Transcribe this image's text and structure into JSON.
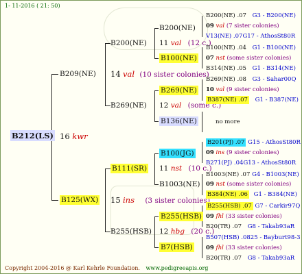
{
  "header": {
    "date": "1- 11-2016 ( 21: 50)"
  },
  "footer": {
    "copyright": "Copyright 2004-2016 @ Karl Kehrle Foundation.",
    "url": "www.pedigreeapis.org"
  },
  "root": {
    "name": "B212(LS)",
    "count": "16",
    "rel": "kwr"
  },
  "gen1": [
    {
      "name": "B209(NE)",
      "count": "14",
      "rel": "val",
      "note": "(10 sister colonies)"
    },
    {
      "name": "B125(WX)",
      "count": "15",
      "rel": "ins",
      "note": "(3 sister colonies)"
    }
  ],
  "gen2": [
    {
      "name": "B200(NE)",
      "count": "11",
      "rel": "val",
      "note": "(12 c.)"
    },
    {
      "name": "B269(NE)",
      "count": "12",
      "rel": "val",
      "note": "(some c.)"
    },
    {
      "name": "B111(SR)",
      "count": "11",
      "rel": "nst",
      "note": "(10 c.)"
    },
    {
      "name": "B255(HSB)",
      "count": "12",
      "rel": "hbg",
      "note": "(20 c.)"
    }
  ],
  "gen3": [
    {
      "name": "B200(NE)"
    },
    {
      "name": "B100(NE)"
    },
    {
      "name": "B269(NE)"
    },
    {
      "name": "B136(NE)"
    },
    {
      "name": "B100(JG)"
    },
    {
      "name": "B1003(NE)"
    },
    {
      "name": "B255(HSB)"
    },
    {
      "name": "B7(HSB)"
    }
  ],
  "gen4": {
    "g1": {
      "a": "B200(NE) .07",
      "b": "G3 - B200(NE)",
      "c": "09",
      "d": "val",
      "e": "(7 sister colonies)",
      "f": "V13(NE) .07G17 - AthosSt80R"
    },
    "g2": {
      "a": "B100(NE) .04",
      "b": "G1 - B100(NE)",
      "c": "07",
      "d": "nst",
      "e": "(some sister colonies)",
      "f": "B314(NE) .05",
      "g": "G1 - B314(NE)"
    },
    "g3": {
      "a": "B269(NE) .08",
      "b": "G3 - Sahar00Q",
      "c": "10",
      "d": "val",
      "e": "(9 sister colonies)",
      "f": "B387(NE) .07",
      "g": "G1 - B387(NE)"
    },
    "g4": {
      "a": "no more"
    },
    "g5": {
      "a": "B201(PJ) .07",
      "b": "G15 - AthosSt80R",
      "c": "09",
      "d": "ins",
      "e": "(9 sister colonies)",
      "f": "B271(PJ) .04G13 - AthosSt80R"
    },
    "g6": {
      "a": "B1003(NE) .07",
      "b": "G4 - B1003(NE)",
      "c": "09",
      "d": "nst",
      "e": "(some sister colonies)",
      "f": "B384(NE) .06",
      "g": "G1 - B384(NE)"
    },
    "g7": {
      "a": "B255(HSB) .07",
      "b": "G7 - Carkir97Q",
      "c": "09",
      "d": "fhl",
      "e": "(33 sister colonies)",
      "f": "B20(TR) .07",
      "g": "G8 - Takab93aR"
    },
    "g8": {
      "a": "B507(HSB) .0825 - Bayburt98-3",
      "c": "09",
      "d": "fhl",
      "e": "(33 sister colonies)",
      "f": "B20(TR) .07",
      "g": "G8 - Takab93aR"
    }
  }
}
